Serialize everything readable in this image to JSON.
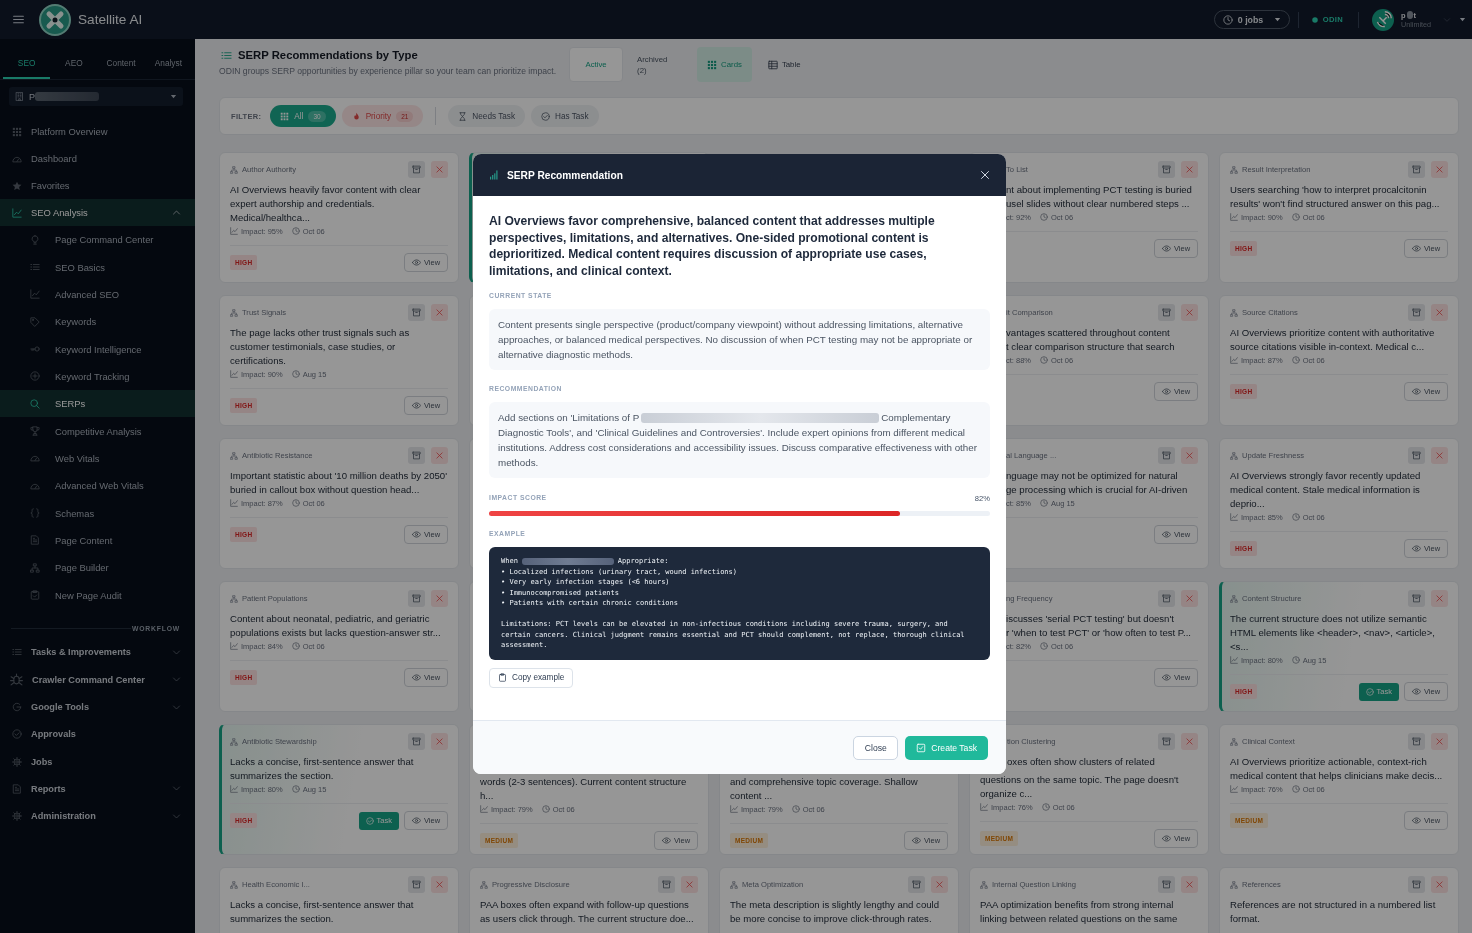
{
  "topbar": {
    "app_name": "Satellite AI",
    "jobs": "0 jobs",
    "status": "ODIN",
    "user": {
      "name_parts": [
        "p",
        "t"
      ],
      "plan": "Unlimited"
    }
  },
  "sidebar": {
    "tabs": [
      {
        "label": "SEO",
        "selected": true
      },
      {
        "label": "AEO",
        "selected": false
      },
      {
        "label": "Content",
        "selected": false
      },
      {
        "label": "Analyst",
        "selected": false
      }
    ],
    "project": "P",
    "items": [
      {
        "label": "Platform Overview",
        "selected": false
      },
      {
        "label": "Dashboard",
        "selected": false
      },
      {
        "label": "Favorites",
        "selected": false
      },
      {
        "label": "SEO Analysis",
        "selected": true,
        "expanded": true,
        "children": [
          {
            "label": "Page Command Center",
            "selected": false
          },
          {
            "label": "SEO Basics",
            "selected": false
          },
          {
            "label": "Advanced SEO",
            "selected": false
          },
          {
            "label": "Keywords",
            "selected": false
          },
          {
            "label": "Keyword Intelligence",
            "selected": false
          },
          {
            "label": "Keyword Tracking",
            "selected": false
          },
          {
            "label": "SERPs",
            "selected": true
          },
          {
            "label": "Competitive Analysis",
            "selected": false
          },
          {
            "label": "Web Vitals",
            "selected": false
          },
          {
            "label": "Advanced Web Vitals",
            "selected": false
          },
          {
            "label": "Schemas",
            "selected": false
          },
          {
            "label": "Page Content",
            "selected": false
          },
          {
            "label": "Page Builder",
            "selected": false
          },
          {
            "label": "New Page Audit",
            "selected": false
          }
        ]
      }
    ],
    "section_label": "WORKFLOW",
    "workflow": [
      {
        "label": "Tasks & Improvements",
        "selected": false,
        "expanded": false
      },
      {
        "label": "Crawler Command Center",
        "selected": false,
        "expanded": false
      },
      {
        "label": "Google Tools",
        "selected": false,
        "expanded": false
      },
      {
        "label": "Approvals",
        "selected": false
      },
      {
        "label": "Jobs",
        "selected": false
      },
      {
        "label": "Reports",
        "selected": false,
        "expanded": false
      },
      {
        "label": "Administration",
        "selected": false,
        "expanded": false
      }
    ]
  },
  "page": {
    "title": "SERP Recommendations by Type",
    "subtitle": "ODIN groups SERP opportunities by experience pillar so your team can prioritize impact.",
    "status_tabs": [
      {
        "label": "Active",
        "selected": true
      },
      {
        "label": "Archived",
        "count": "(2)",
        "selected": false
      }
    ],
    "view_tabs": [
      {
        "label": "Cards",
        "selected": true
      },
      {
        "label": "Table",
        "selected": false
      }
    ],
    "filter": {
      "label": "FILTER:",
      "chips": [
        {
          "kind": "all",
          "label": "All",
          "count": "30",
          "selected": true
        },
        {
          "kind": "priority",
          "label": "Priority",
          "count": "21",
          "selected": false
        },
        {
          "kind": "needs",
          "label": "Needs Task",
          "selected": false
        },
        {
          "kind": "has",
          "label": "Has Task",
          "selected": false
        }
      ]
    }
  },
  "cards": [
    {
      "kind": "full",
      "category": "Author Authority",
      "text": "AI Overviews heavily favor content with clear expert authorship and credentials. Medical/healthca...",
      "impact": "Impact: 95%",
      "date": "Oct 06",
      "priority": {
        "label": "HIGH",
        "kind": "high"
      },
      "view": "View",
      "selected": false
    },
    {
      "kind": "edge",
      "selected": true
    },
    {
      "kind": "covered"
    },
    {
      "kind": "right_part",
      "category": "To List",
      "lines": [
        "nt about implementing PCT testing is buried",
        "usel slides without clear numbered steps ..."
      ],
      "impact": "ct: 92%",
      "date": "Oct 06",
      "view": "View",
      "selected": false
    },
    {
      "kind": "full",
      "category": "Result Interpretation",
      "text": "Users searching 'how to interpret procalcitonin results' won't find structured answer on this pag...",
      "impact": "Impact: 90%",
      "date": "Oct 06",
      "priority": {
        "label": "HIGH",
        "kind": "high"
      },
      "view": "View",
      "selected": false
    },
    {
      "kind": "full",
      "category": "Trust Signals",
      "text": "The page lacks other trust signals such as customer testimonials, case studies, or certifications.",
      "impact": "Impact: 90%",
      "date": "Aug 15",
      "priority": {
        "label": "HIGH",
        "kind": "high"
      },
      "view": "View",
      "selected": false
    },
    {
      "kind": "edge",
      "selected": false
    },
    {
      "kind": "covered"
    },
    {
      "kind": "right_part",
      "category": "it Comparison",
      "lines": [
        "vantages scattered throughout content",
        "t clear comparison structure that search"
      ],
      "impact": "ct: 88%",
      "date": "Oct 06",
      "view": "View",
      "selected": false
    },
    {
      "kind": "full",
      "category": "Source Citations",
      "text": "AI Overviews prioritize content with authoritative source citations visible in-context. Medical c...",
      "impact": "Impact: 87%",
      "date": "Oct 06",
      "priority": {
        "label": "HIGH",
        "kind": "high"
      },
      "view": "View",
      "selected": false
    },
    {
      "kind": "full",
      "category": "Antibiotic Resistance",
      "text": "Important statistic about '10 million deaths by 2050' buried in callout box without question head...",
      "impact": "Impact: 87%",
      "date": "Oct 06",
      "priority": {
        "label": "HIGH",
        "kind": "high"
      },
      "view": "View",
      "selected": false
    },
    {
      "kind": "edge",
      "selected": false
    },
    {
      "kind": "covered"
    },
    {
      "kind": "right_part",
      "category": "al Language ...",
      "lines": [
        "nguage may not be optimized for natural",
        "ge processing which is crucial for AI-driven"
      ],
      "impact": "ct: 85%",
      "date": "Aug 15",
      "view": "View",
      "selected": false
    },
    {
      "kind": "full",
      "category": "Update Freshness",
      "text": "AI Overviews strongly favor recently updated medical content. Stale medical information is deprio...",
      "impact": "Impact: 85%",
      "date": "Oct 06",
      "priority": {
        "label": "HIGH",
        "kind": "high"
      },
      "view": "View",
      "selected": false
    },
    {
      "kind": "full",
      "category": "Patient Populations",
      "text": "Content about neonatal, pediatric, and geriatric populations exists but lacks question-answer str...",
      "impact": "Impact: 84%",
      "date": "Oct 06",
      "priority": {
        "label": "HIGH",
        "kind": "high"
      },
      "view": "View",
      "selected": false
    },
    {
      "kind": "edge",
      "selected": false
    },
    {
      "kind": "covered"
    },
    {
      "kind": "right_part",
      "category": "ng Frequency",
      "lines": [
        "iscusses 'serial PCT testing' but doesn't",
        "r 'when to test PCT' or 'how often to test P..."
      ],
      "impact": "ct: 82%",
      "date": "Oct 06",
      "view": "View",
      "selected": false
    },
    {
      "kind": "full",
      "category": "Content Structure",
      "text": "The current structure does not utilize semantic HTML elements like <header>, <nav>, <article>, <s...",
      "impact": "Impact: 80%",
      "date": "Aug 15",
      "priority": {
        "label": "HIGH",
        "kind": "high"
      },
      "task": "Task",
      "view": "View",
      "selected": true
    },
    {
      "kind": "full",
      "category": "Antibiotic Stewardship",
      "text": "Lacks a concise, first-sentence answer that summarizes the section.",
      "impact": "Impact: 80%",
      "date": "Aug 15",
      "priority": {
        "label": "HIGH",
        "kind": "high"
      },
      "task": "Task",
      "view": "View",
      "selected": true
    },
    {
      "kind": "lower_part",
      "lines": [
        "words (2-3 sentences). Current content structure",
        "h..."
      ],
      "impact": "Impact: 79%",
      "date": "Oct 06",
      "priority": {
        "label": "MEDIUM",
        "kind": "medium"
      },
      "view": "View",
      "selected": false
    },
    {
      "kind": "lower_part",
      "lines": [
        "and comprehensive topic coverage. Shallow",
        "content ..."
      ],
      "impact": "Impact: 79%",
      "date": "Oct 06",
      "priority": {
        "label": "MEDIUM",
        "kind": "medium"
      },
      "view": "View",
      "selected": false
    },
    {
      "kind": "corner",
      "category": "tion Clustering",
      "lines": [
        "oxes often show clusters of related",
        "questions on the same topic. The page doesn't",
        "organize c..."
      ],
      "impact": "Impact: 76%",
      "date": "Oct 06",
      "priority": {
        "label": "MEDIUM",
        "kind": "medium"
      },
      "view": "View",
      "selected": false
    },
    {
      "kind": "full",
      "category": "Clinical Context",
      "text": "AI Overviews prioritize actionable, context-rich medical content that helps clinicians make decis...",
      "impact": "Impact: 76%",
      "date": "Oct 06",
      "priority": {
        "label": "MEDIUM",
        "kind": "medium"
      },
      "view": "View",
      "selected": false
    },
    {
      "kind": "full",
      "category": "Health Economic I...",
      "text": "Lacks a concise, first-sentence answer that summarizes the section.",
      "selected": false
    },
    {
      "kind": "full",
      "category": "Progressive Disclosure",
      "text": "PAA boxes often expand with follow-up questions as users click through. The current structure doe...",
      "selected": false
    },
    {
      "kind": "full",
      "category": "Meta Optimization",
      "text": "The meta description is slightly lengthy and could be more concise to improve click-through rates.",
      "selected": false
    },
    {
      "kind": "full",
      "category": "Internal Question Linking",
      "text": "PAA optimization benefits from strong internal linking between related questions on the same",
      "selected": false
    },
    {
      "kind": "full",
      "category": "References",
      "text": "References are not structured in a numbered list format.",
      "selected": false
    }
  ],
  "dialog": {
    "title": "SERP Recommendation",
    "heading": "AI Overviews favor comprehensive, balanced content that addresses multiple perspectives, limitations, and alternatives. One-sided promotional content is deprioritized. Medical content requires discussion of appropriate use cases, limitations, and clinical context.",
    "current_state": {
      "label": "CURRENT STATE",
      "text": "Content presents single perspective (product/company viewpoint) without addressing limitations, alternative approaches, or balanced medical perspectives. No discussion of when PCT testing may not be appropriate or alternative diagnostic methods."
    },
    "recommendation": {
      "label": "RECOMMENDATION",
      "lines": [
        [
          "Add sections on 'Limitations of P",
          "Complementary"
        ],
        [
          "Diagnostic Tools', and 'Clinical Guidelines and Controversies'. Include expert opinions from different medical"
        ],
        [
          "institutions. Address cost considerations and accessibility issues. Discuss comparative effectiveness with other"
        ],
        [
          "methods."
        ]
      ]
    },
    "impact": {
      "label": "IMPACT SCORE",
      "value": "82%",
      "level": 0.82
    },
    "example": {
      "label": "EXAMPLE",
      "lines": [
        [
          "When",
          "Appropriate:"
        ],
        [
          "• Localized infections (urinary tract, wound infections)"
        ],
        [
          "• Very early infection stages (<6 hours)"
        ],
        [
          "• Immunocompromised patients"
        ],
        [
          "• Patients with certain chronic conditions"
        ]
      ],
      "note": "Limitations: PCT levels can be elevated in non-infectious conditions including severe trauma, surgery, and certain cancers. Clinical judgment remains essential and PCT should complement, not replace, thorough clinical assessment.",
      "copy": "Copy example"
    },
    "buttons": [
      {
        "kind": "secondary",
        "label": "Close"
      },
      {
        "kind": "primary",
        "label": "Create Task"
      }
    ]
  }
}
